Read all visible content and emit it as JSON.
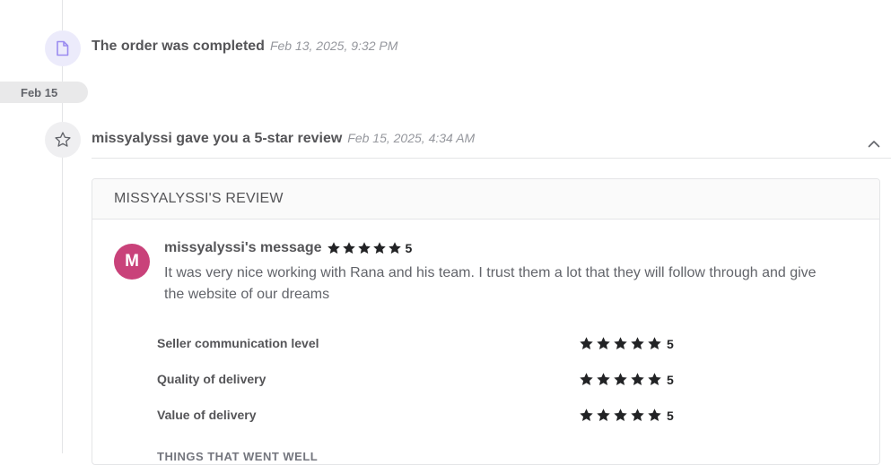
{
  "timeline": {
    "events": [
      {
        "icon": "document-icon",
        "title": "The order was completed",
        "time": "Feb 13, 2025, 9:32 PM"
      },
      {
        "icon": "star-outline-icon",
        "title": "missyalyssi gave you a 5-star review",
        "time": "Feb 15, 2025, 4:34 AM"
      }
    ],
    "date_separator": "Feb 15"
  },
  "review": {
    "header": "MISSYALYSSI'S REVIEW",
    "avatar_letter": "M",
    "avatar_color": "#c9427a",
    "author_label": "missyalyssi's message",
    "overall_rating": "5",
    "message": "It was very nice working with Rana and his team. I trust them a lot that they will follow through and give the website of our dreams",
    "ratings": [
      {
        "label": "Seller communication level",
        "value": "5"
      },
      {
        "label": "Quality of delivery",
        "value": "5"
      },
      {
        "label": "Value of delivery",
        "value": "5"
      }
    ],
    "things_heading": "THINGS THAT WENT WELL"
  },
  "colors": {
    "star": "#222325",
    "icon_purple": "#9b8cf0",
    "line": "#e4e5e7"
  }
}
